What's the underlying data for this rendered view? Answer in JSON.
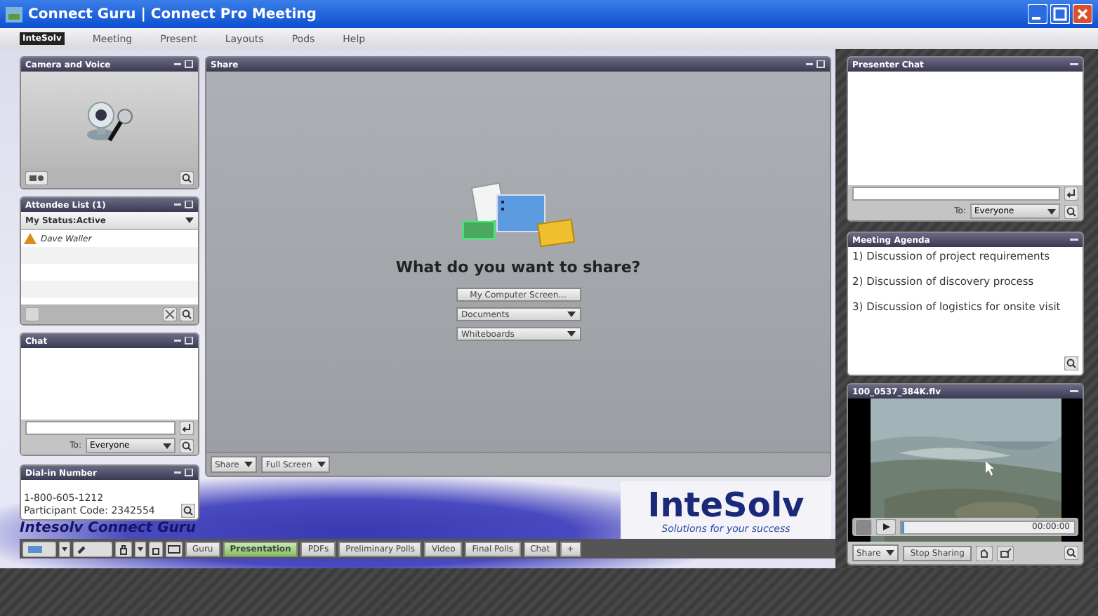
{
  "window": {
    "title": "Connect Guru | Connect Pro Meeting"
  },
  "menu": {
    "logo": "InteSolv",
    "items": [
      "Meeting",
      "Present",
      "Layouts",
      "Pods",
      "Help"
    ]
  },
  "camera_voice": {
    "title": "Camera and Voice"
  },
  "attendees": {
    "title": "Attendee List (1)",
    "status": "My Status:Active",
    "people": [
      "Dave Waller"
    ]
  },
  "chat": {
    "title": "Chat",
    "to_label": "To:",
    "recipient": "Everyone"
  },
  "dial_in": {
    "title": "Dial-in Number",
    "phone": "1-800-605-1212",
    "code": "Participant Code: 2342554"
  },
  "share": {
    "title": "Share",
    "prompt": "What do you want to share?",
    "options": [
      {
        "label": "My Computer Screen...",
        "kind": "button"
      },
      {
        "label": "Documents",
        "kind": "dropdown"
      },
      {
        "label": "Whiteboards",
        "kind": "dropdown"
      }
    ],
    "footer": [
      "Share",
      "Full Screen"
    ]
  },
  "brand": {
    "caption": "Intesolv Connect Guru",
    "logo": "InteSolv",
    "tagline": "Solutions for your success"
  },
  "toolbar": {
    "tabs": [
      {
        "label": "Guru",
        "selected": false
      },
      {
        "label": "Presentation",
        "selected": true
      },
      {
        "label": "PDFs",
        "selected": false
      },
      {
        "label": "Preliminary Polls",
        "selected": false
      },
      {
        "label": "Video",
        "selected": false
      },
      {
        "label": "Final Polls",
        "selected": false
      },
      {
        "label": "Chat",
        "selected": false
      }
    ],
    "add": "+"
  },
  "presenter_chat": {
    "title": "Presenter Chat",
    "to_label": "To:",
    "recipient": "Everyone"
  },
  "agenda": {
    "title": "Meeting Agenda",
    "items": [
      "1) Discussion of project requirements",
      "2) Discussion of discovery process",
      "3) Discussion of logistics for onsite visit"
    ]
  },
  "video": {
    "title": "100_0537_384K.flv",
    "time": "00:00:00",
    "level": 0,
    "buttons": [
      "Share",
      "Stop Sharing"
    ]
  }
}
